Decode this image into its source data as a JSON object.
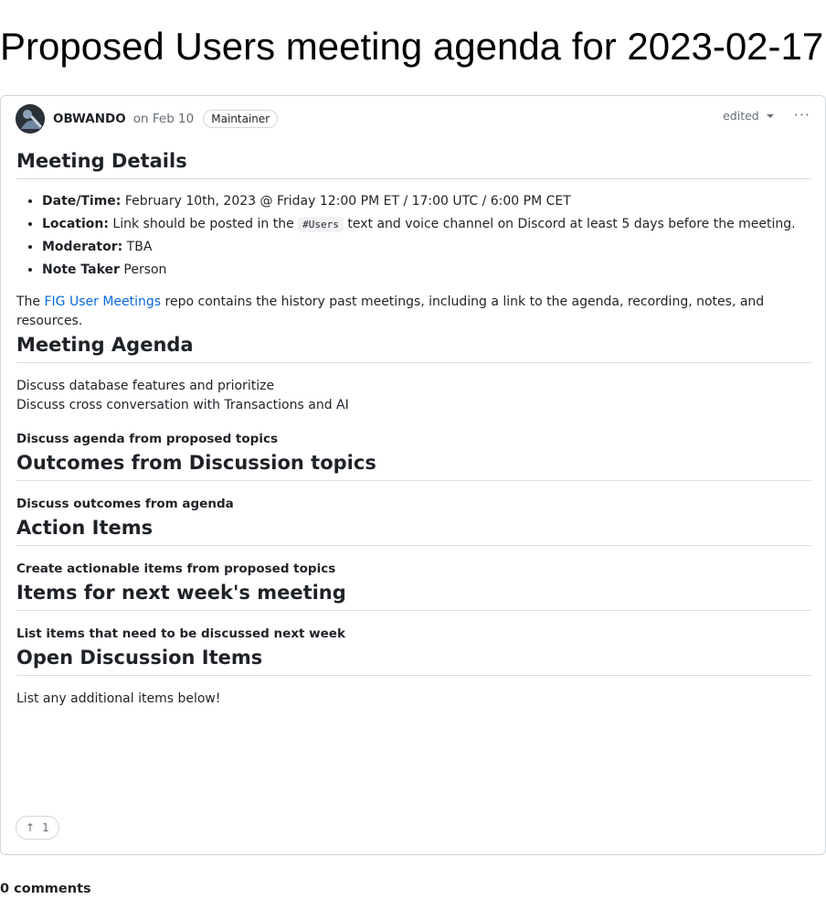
{
  "page": {
    "title": "Proposed Users meeting agenda for 2023-02-17"
  },
  "post": {
    "author": "OBWANDO",
    "date": "on Feb 10",
    "badge": "Maintainer",
    "edited_label": "edited",
    "more_label": "···"
  },
  "sections": {
    "meeting_details": {
      "heading": "Meeting Details",
      "items": [
        {
          "label": "Date/Time:",
          "text": " February 10th, 2023 @ Friday 12:00 PM ET / 17:00 UTC / 6:00 PM CET"
        },
        {
          "label": "Location:",
          "text_before": " Link should be posted in the ",
          "code": "#Users",
          "text_after": " text and voice channel on Discord at least 5 days before the meeting."
        },
        {
          "label": "Moderator:",
          "text": " TBA"
        },
        {
          "label": "Note Taker",
          "text": " Person"
        }
      ],
      "para_before": "The ",
      "para_link": "FIG User Meetings",
      "para_after": " repo contains the history past meetings, including a link to the agenda, recording, notes, and resources."
    },
    "meeting_agenda": {
      "heading": "Meeting Agenda",
      "line1": "Discuss database features and prioritize",
      "line2": "Discuss cross conversation with Transactions and AI",
      "bold": "Discuss agenda from proposed topics"
    },
    "outcomes": {
      "heading": "Outcomes from Discussion topics",
      "bold": "Discuss outcomes from agenda"
    },
    "action_items": {
      "heading": "Action Items",
      "bold": "Create actionable items from proposed topics"
    },
    "next_week": {
      "heading": "Items for next week's meeting",
      "bold": "List items that need to be discussed next week"
    },
    "open_discussion": {
      "heading": "Open Discussion Items",
      "text": "List any additional items below!"
    }
  },
  "reaction": {
    "icon": "arrow-up-icon",
    "glyph": "↑",
    "count": "1"
  },
  "comments": {
    "label": "0 comments"
  },
  "colors": {
    "link": "#0969da",
    "border": "#d0d7de",
    "muted": "#656d76",
    "text": "#1f2328"
  }
}
